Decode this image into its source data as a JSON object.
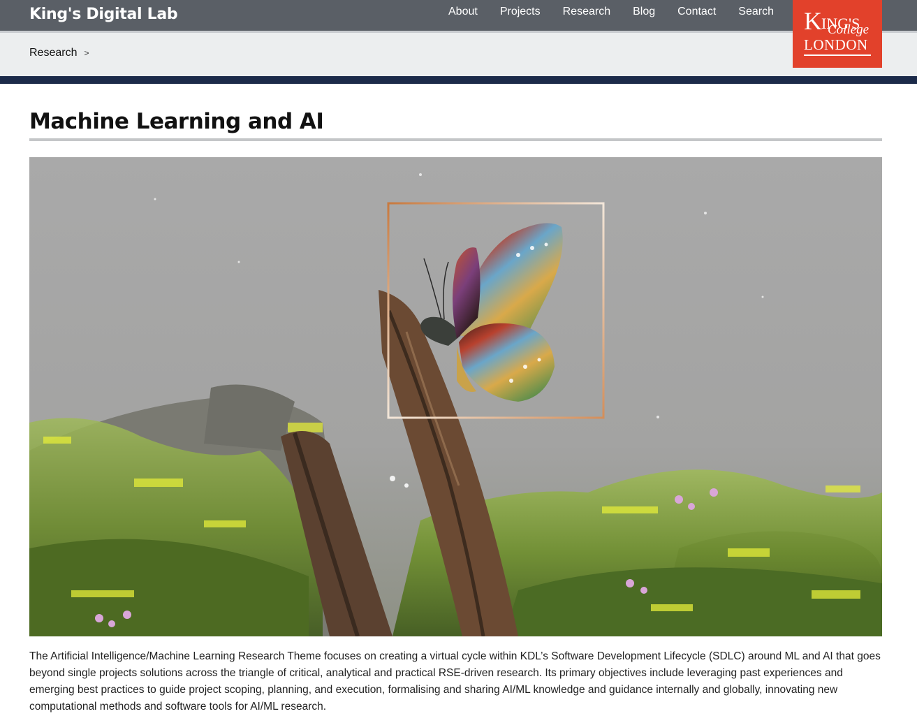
{
  "header": {
    "site_title": "King's Digital Lab",
    "nav": [
      "About",
      "Projects",
      "Research",
      "Blog",
      "Contact",
      "Search"
    ],
    "logo": {
      "line1_big": "K",
      "line1_rest": "ING'S",
      "line2": "College",
      "line3": "LONDON",
      "bg": "#e2412b"
    }
  },
  "breadcrumb": {
    "items": [
      "Research"
    ],
    "separator": ">"
  },
  "page": {
    "title": "Machine Learning and AI",
    "hero_image": "butterfly-on-branch-image",
    "description": "The Artificial Intelligence/Machine Learning Research Theme focuses on creating a virtual cycle within KDL’s Software Development Lifecycle (SDLC) around ML and AI that goes beyond single projects solutions across the triangle of critical, analytical and practical RSE-driven research. Its primary objectives include leveraging past experiences and emerging best practices to guide project scoping, planning, and execution, formalising and sharing AI/ML knowledge and guidance internally and globally, innovating new computational methods and software tools for AI/ML research."
  },
  "colors": {
    "topbar": "#5a5f66",
    "subbar": "#eceeef",
    "navy": "#1c2b4a",
    "accent": "#e2412b"
  }
}
